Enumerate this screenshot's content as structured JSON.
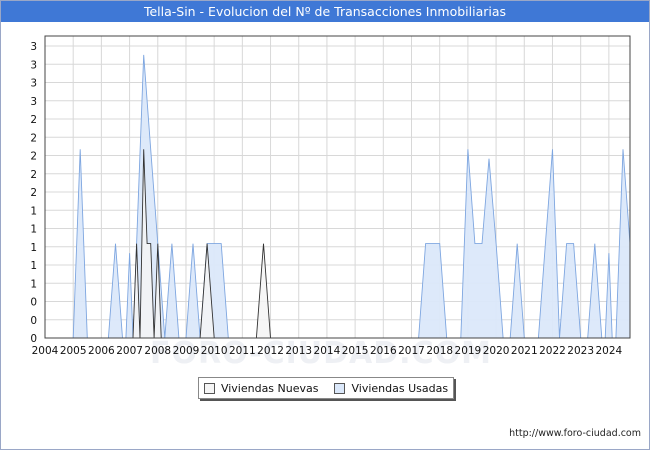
{
  "chart_data": {
    "type": "area",
    "title": "Tella-Sin - Evolucion del Nº de Transacciones Inmobiliarias",
    "xlabel": "",
    "ylabel": "",
    "x_ticks": [
      "2004",
      "2005",
      "2006",
      "2007",
      "2008",
      "2009",
      "2010",
      "2011",
      "2012",
      "2013",
      "2014",
      "2015",
      "2016",
      "2017",
      "2018",
      "2019",
      "2020",
      "2021",
      "2022",
      "2023",
      "2024"
    ],
    "y_tick_labels": [
      "0",
      "0",
      "0",
      "1",
      "1",
      "1",
      "1",
      "1",
      "2",
      "2",
      "2",
      "2",
      "2",
      "3",
      "3",
      "3",
      "3"
    ],
    "xlim": [
      2004,
      2024.75
    ],
    "ylim": [
      0,
      3.2
    ],
    "grid": true,
    "legend_position": "bottom",
    "series": [
      {
        "name": "Viviendas Nuevas",
        "color": "#f5f5f5",
        "stroke": "#333333",
        "points": [
          [
            2004.0,
            0
          ],
          [
            2007.12,
            0
          ],
          [
            2007.25,
            1
          ],
          [
            2007.37,
            0
          ],
          [
            2007.5,
            2
          ],
          [
            2007.62,
            1
          ],
          [
            2007.75,
            1
          ],
          [
            2007.87,
            0
          ],
          [
            2008.0,
            1
          ],
          [
            2008.12,
            0
          ],
          [
            2009.5,
            0
          ],
          [
            2009.75,
            1
          ],
          [
            2010.0,
            0
          ],
          [
            2011.5,
            0
          ],
          [
            2011.75,
            1
          ],
          [
            2012.0,
            0
          ],
          [
            2024.75,
            0
          ]
        ]
      },
      {
        "name": "Viviendas Usadas",
        "color": "#dbe8fa",
        "stroke": "#7ea6e0",
        "points": [
          [
            2004.0,
            0
          ],
          [
            2005.0,
            0
          ],
          [
            2005.25,
            2
          ],
          [
            2005.5,
            0
          ],
          [
            2006.25,
            0
          ],
          [
            2006.5,
            1
          ],
          [
            2006.75,
            0
          ],
          [
            2006.87,
            0
          ],
          [
            2007.0,
            0.9
          ],
          [
            2007.12,
            0
          ],
          [
            2007.25,
            1
          ],
          [
            2007.5,
            3
          ],
          [
            2007.75,
            2
          ],
          [
            2008.0,
            1
          ],
          [
            2008.25,
            0
          ],
          [
            2008.5,
            1
          ],
          [
            2008.75,
            0
          ],
          [
            2009.0,
            0
          ],
          [
            2009.25,
            1
          ],
          [
            2009.5,
            0
          ],
          [
            2009.75,
            1
          ],
          [
            2010.0,
            1
          ],
          [
            2010.25,
            1
          ],
          [
            2010.5,
            0
          ],
          [
            2017.25,
            0
          ],
          [
            2017.5,
            1
          ],
          [
            2017.75,
            1
          ],
          [
            2018.0,
            1
          ],
          [
            2018.25,
            0
          ],
          [
            2018.75,
            0
          ],
          [
            2019.0,
            2
          ],
          [
            2019.25,
            1
          ],
          [
            2019.5,
            1
          ],
          [
            2019.75,
            1.9
          ],
          [
            2020.0,
            1
          ],
          [
            2020.25,
            0
          ],
          [
            2020.5,
            0
          ],
          [
            2020.75,
            1
          ],
          [
            2021.0,
            0
          ],
          [
            2021.5,
            0
          ],
          [
            2021.75,
            1
          ],
          [
            2022.0,
            2
          ],
          [
            2022.25,
            0
          ],
          [
            2022.5,
            1
          ],
          [
            2022.75,
            1
          ],
          [
            2023.0,
            0
          ],
          [
            2023.25,
            0
          ],
          [
            2023.5,
            1
          ],
          [
            2023.75,
            0
          ],
          [
            2023.87,
            0
          ],
          [
            2024.0,
            0.9
          ],
          [
            2024.12,
            0
          ],
          [
            2024.25,
            0
          ],
          [
            2024.5,
            2
          ],
          [
            2024.75,
            1
          ]
        ]
      }
    ]
  },
  "footer": {
    "url": "http://www.foro-ciudad.com"
  },
  "watermark": "FORO-CIUDAD.COM"
}
